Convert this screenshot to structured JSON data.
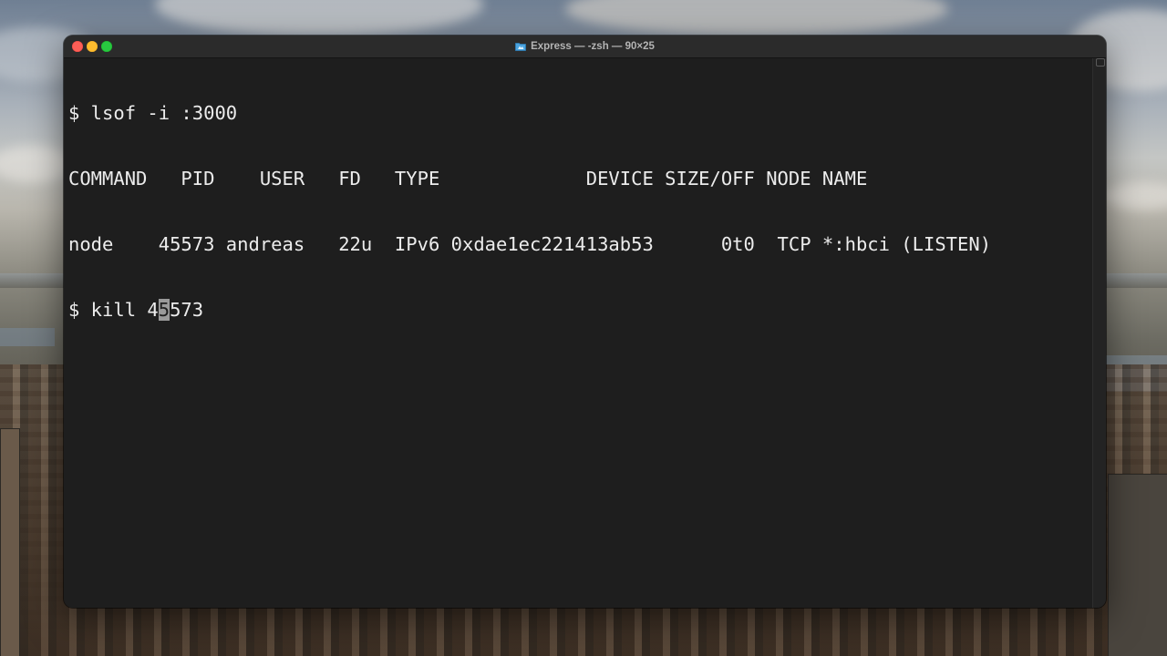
{
  "window": {
    "title": "Express — -zsh — 90×25",
    "folder_icon": "folder-icon"
  },
  "terminal": {
    "lines": [
      "$ lsof -i :3000",
      "COMMAND   PID    USER   FD   TYPE             DEVICE SIZE/OFF NODE NAME",
      "node    45573 andreas   22u  IPv6 0xdae1ec221413ab53      0t0  TCP *:hbci (LISTEN)"
    ],
    "prompt_line": {
      "before_cursor": "$ kill 4",
      "cursor_char": "5",
      "after_cursor": "573"
    }
  },
  "colors": {
    "terminal_bg": "#1e1e1e",
    "terminal_fg": "#ececec",
    "titlebar_bg": "#2b2b2b",
    "close": "#fe5f57",
    "minimize": "#febc2e",
    "maximize": "#28c840"
  }
}
